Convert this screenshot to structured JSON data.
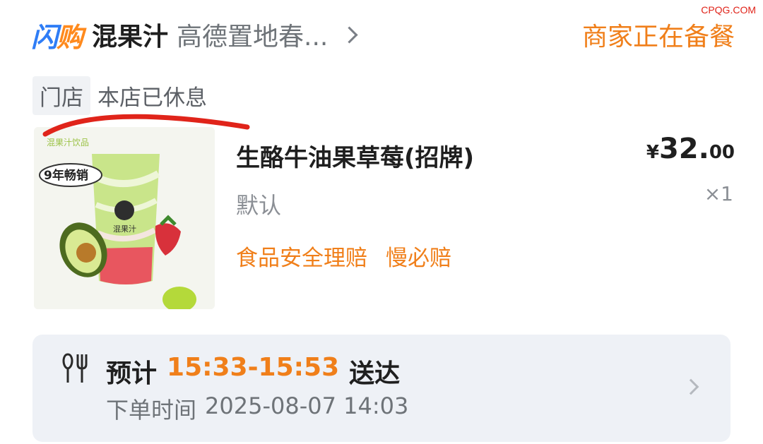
{
  "watermark": "CPQG.COM",
  "header": {
    "brand_part1": "闪",
    "brand_part2": "购",
    "shop_name": "混果汁",
    "branch": "高德置地春...",
    "order_status": "商家正在备餐"
  },
  "store": {
    "tag": "门店",
    "state": "本店已休息"
  },
  "product": {
    "name": "生酪牛油果草莓(招牌)",
    "spec": "默认",
    "price_currency": "¥",
    "price_int": "32.",
    "price_dec": "00",
    "quantity": "×1",
    "tags": [
      "食品安全理赔",
      "慢必赔"
    ],
    "image_badge": "9年畅销",
    "image_brand": "混果汁",
    "image_top_label": "混果汁饮品"
  },
  "delivery": {
    "label": "预计",
    "time_range": "15:33-15:53",
    "suffix": "送达",
    "order_time_label": "下单时间",
    "order_time": "2025-08-07 14:03"
  },
  "colors": {
    "accent_orange": "#f07f1a",
    "brand_blue": "#2f7df6",
    "annotation_red": "#e0241a"
  }
}
